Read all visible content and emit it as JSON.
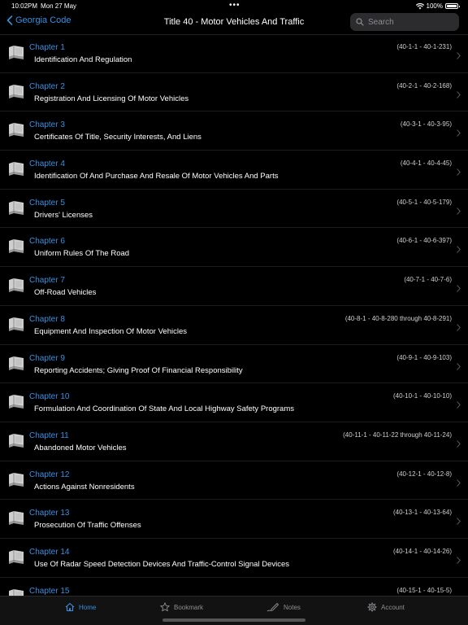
{
  "status_bar": {
    "time": "10:02PM",
    "date": "Mon 27 May",
    "battery": "100%"
  },
  "nav": {
    "back_label": "Georgia Code",
    "title": "Title 40 - Motor Vehicles And Traffic",
    "search_placeholder": "Search"
  },
  "chapters": [
    {
      "label": "Chapter  1",
      "title": "Identification And Regulation",
      "range": "(40-1-1 - 40-1-231)"
    },
    {
      "label": "Chapter  2",
      "title": "Registration And Licensing Of Motor Vehicles",
      "range": "(40-2-1 - 40-2-168)"
    },
    {
      "label": "Chapter  3",
      "title": "Certificates Of Title, Security Interests, And Liens",
      "range": "(40-3-1 - 40-3-95)"
    },
    {
      "label": "Chapter  4",
      "title": "Identification Of And Purchase And Resale Of Motor Vehicles And Parts",
      "range": "(40-4-1 - 40-4-45)"
    },
    {
      "label": "Chapter  5",
      "title": "Drivers' Licenses",
      "range": "(40-5-1 - 40-5-179)"
    },
    {
      "label": "Chapter  6",
      "title": "Uniform Rules Of The Road",
      "range": "(40-6-1 - 40-6-397)"
    },
    {
      "label": "Chapter  7",
      "title": "Off-Road Vehicles",
      "range": "(40-7-1 - 40-7-6)"
    },
    {
      "label": "Chapter  8",
      "title": "Equipment And Inspection Of Motor Vehicles",
      "range": "(40-8-1 - 40-8-280 through 40-8-291)"
    },
    {
      "label": "Chapter  9",
      "title": "Reporting Accidents; Giving Proof Of Financial Responsibility",
      "range": "(40-9-1 - 40-9-103)"
    },
    {
      "label": "Chapter  10",
      "title": "Formulation And Coordination Of State And Local Highway Safety Programs",
      "range": "(40-10-1 - 40-10-10)"
    },
    {
      "label": "Chapter  11",
      "title": "Abandoned Motor Vehicles",
      "range": "(40-11-1 - 40-11-22 through 40-11-24)"
    },
    {
      "label": "Chapter  12",
      "title": "Actions Against Nonresidents",
      "range": "(40-12-1 - 40-12-8)"
    },
    {
      "label": "Chapter  13",
      "title": "Prosecution Of Traffic Offenses",
      "range": "(40-13-1 - 40-13-64)"
    },
    {
      "label": "Chapter  14",
      "title": "Use Of Radar Speed Detection Devices And Traffic-Control Signal Devices",
      "range": "(40-14-1 - 40-14-26)"
    },
    {
      "label": "Chapter  15",
      "title": "",
      "range": "(40-15-1 - 40-15-5)"
    }
  ],
  "tabs": [
    {
      "label": "Home",
      "icon": "home-icon",
      "active": true
    },
    {
      "label": "Bookmark",
      "icon": "star-icon",
      "active": false
    },
    {
      "label": "Notes",
      "icon": "pen-icon",
      "active": false
    },
    {
      "label": "Account",
      "icon": "gear-icon",
      "active": false
    }
  ],
  "colors": {
    "accent": "#3a8fe0",
    "background": "#000000",
    "inactive": "#8e8e93"
  }
}
